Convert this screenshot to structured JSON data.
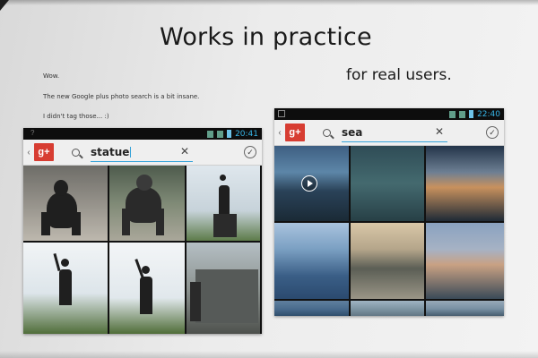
{
  "slide": {
    "title": "Works in practice",
    "subtitle": "for real users.",
    "quote_lines": [
      "Wow.",
      "The new Google plus photo search is a bit insane.",
      "I didn't tag those... :)"
    ]
  },
  "phone_left": {
    "status_time": "20:41",
    "status_left": "?",
    "search_query": "statue",
    "clear_glyph": "✕",
    "check_glyph": "✓",
    "back_glyph": "‹",
    "logo_text": "g+",
    "thumbnails": [
      "statue photo",
      "gorilla statue photo",
      "statue photo",
      "statue photo",
      "statue photo",
      "building photo"
    ]
  },
  "phone_right": {
    "status_time": "22:40",
    "search_query": "sea",
    "clear_glyph": "✕",
    "check_glyph": "✓",
    "back_glyph": "‹",
    "logo_text": "g+",
    "thumbnails": [
      "sea video",
      "sea photo",
      "sunset sea photo",
      "coast photo",
      "beach photo",
      "shore photo",
      "sea photo",
      "sea photo",
      "sea photo"
    ]
  },
  "icons": {
    "search": "search-icon",
    "clear": "close-icon",
    "check": "check-icon",
    "play": "play-icon"
  },
  "colors": {
    "gplus_red": "#d73d32",
    "android_blue": "#36a3d9"
  }
}
